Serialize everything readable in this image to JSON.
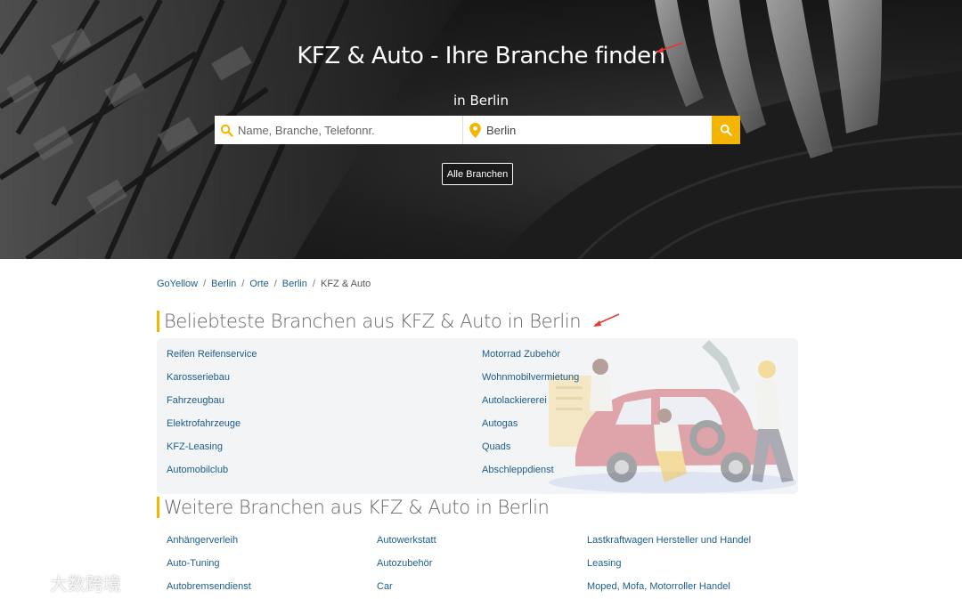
{
  "hero": {
    "title": "KFZ & Auto - Ihre Branche finden",
    "subtitle": "in Berlin",
    "search": {
      "name_placeholder": "Name, Branche, Telefonnr.",
      "location_value": "Berlin"
    },
    "all_button": "Alle Branchen"
  },
  "breadcrumb": [
    "GoYellow",
    "Berlin",
    "Orte",
    "Berlin",
    "KFZ & Auto"
  ],
  "popular": {
    "heading": "Beliebteste Branchen aus KFZ & Auto in Berlin",
    "left": [
      "Reifen Reifenservice",
      "Karosseriebau",
      "Fahrzeugbau",
      "Elektrofahrzeuge",
      "KFZ-Leasing",
      "Automobilclub"
    ],
    "right": [
      "Motorrad Zubehör",
      "Wohnmobilvermietung",
      "Autolackiererei",
      "Autogas",
      "Quads",
      "Abschleppdienst"
    ]
  },
  "more": {
    "heading": "Weitere Branchen aus KFZ & Auto in Berlin",
    "col1": [
      "Anhängerverleih",
      "Auto-Tuning",
      "Autobremsendienst"
    ],
    "col2": [
      "Autowerkstatt",
      "Autozubehör",
      "Car"
    ],
    "col3": [
      "Lastkraftwagen Hersteller und Handel",
      "Leasing",
      "Moped, Mofa, Motorroller Handel"
    ]
  },
  "watermark": "大数跨境",
  "colors": {
    "accent": "#f5b400",
    "link": "#1c5d8c",
    "arrow": "#e53935"
  }
}
